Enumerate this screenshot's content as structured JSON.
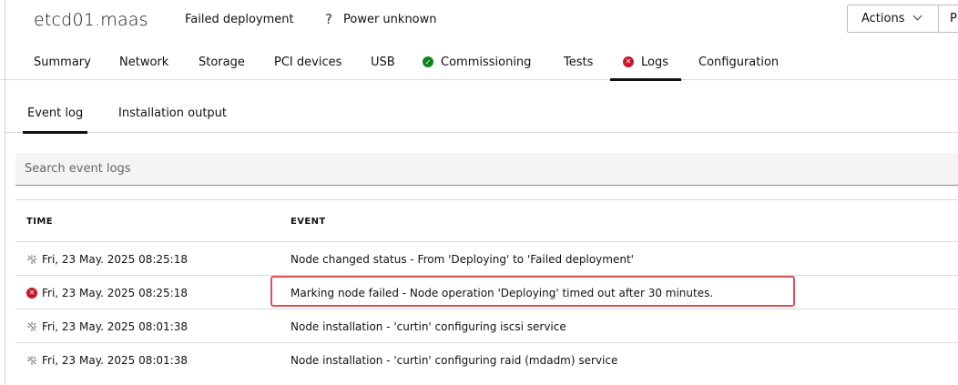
{
  "header": {
    "hostname": "etcd01.maas",
    "status": "Failed deployment",
    "power_icon": "?",
    "power": "Power unknown",
    "actions_label": "Actions",
    "next_button_label": "P"
  },
  "tabs": [
    {
      "label": "Summary",
      "icon": null
    },
    {
      "label": "Network",
      "icon": null
    },
    {
      "label": "Storage",
      "icon": null
    },
    {
      "label": "PCI devices",
      "icon": null
    },
    {
      "label": "USB",
      "icon": null
    },
    {
      "label": "Commissioning",
      "icon": "success-icon"
    },
    {
      "label": "Tests",
      "icon": null
    },
    {
      "label": "Logs",
      "icon": "error-icon",
      "active": true
    },
    {
      "label": "Configuration",
      "icon": null
    }
  ],
  "subtabs": [
    {
      "label": "Event log",
      "active": true
    },
    {
      "label": "Installation output"
    }
  ],
  "search": {
    "placeholder": "Search event logs"
  },
  "table": {
    "headers": {
      "time": "TIME",
      "event": "EVENT"
    },
    "rows": [
      {
        "icon": "in-progress-icon",
        "time": "Fri, 23 May. 2025 08:25:18",
        "event": "Node changed status - From 'Deploying' to 'Failed deployment'"
      },
      {
        "icon": "error-icon",
        "time": "Fri, 23 May. 2025 08:25:18",
        "event": "Marking node failed - Node operation 'Deploying' timed out after 30 minutes.",
        "highlighted": true
      },
      {
        "icon": "in-progress-icon",
        "time": "Fri, 23 May. 2025 08:01:38",
        "event": "Node installation - 'curtin' configuring iscsi service"
      },
      {
        "icon": "in-progress-icon",
        "time": "Fri, 23 May. 2025 08:01:38",
        "event": "Node installation - 'curtin' configuring raid (mdadm) service"
      }
    ]
  },
  "colors": {
    "success": "#0e8420",
    "error": "#c7162b",
    "highlight_border": "#e0505c"
  }
}
